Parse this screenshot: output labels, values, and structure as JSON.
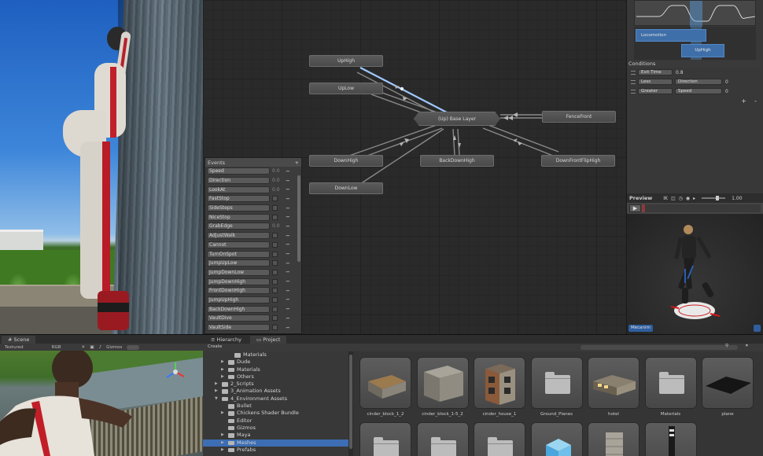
{
  "graph": {
    "states": {
      "uphigh": "UpHigh",
      "uplow": "UpLow",
      "base": "(Up) Base Layer",
      "fencefront": "FenceFront",
      "downhigh": "DownHigh",
      "backdownhigh": "BackDownHigh",
      "downfrontfliphigh": "DownFrontFlipHigh",
      "downlow": "DownLow"
    }
  },
  "events": {
    "title": "Events",
    "add": "+",
    "rows": [
      {
        "name": "Speed",
        "value": "0.0",
        "type": "float"
      },
      {
        "name": "Direction",
        "value": "0.0",
        "type": "float"
      },
      {
        "name": "LookAt",
        "value": "0.0",
        "type": "float"
      },
      {
        "name": "FastStop",
        "type": "bool"
      },
      {
        "name": "SideSteps",
        "type": "bool"
      },
      {
        "name": "NiceStop",
        "type": "bool"
      },
      {
        "name": "GrabEdge",
        "value": "0.0",
        "type": "float"
      },
      {
        "name": "AdjustWalk",
        "type": "bool"
      },
      {
        "name": "Cannot",
        "type": "bool"
      },
      {
        "name": "TurnOnSpot",
        "type": "bool"
      },
      {
        "name": "JumpUpLow",
        "type": "bool"
      },
      {
        "name": "JumpDownLow",
        "type": "bool"
      },
      {
        "name": "JumpDownHigh",
        "type": "bool"
      },
      {
        "name": "FrontDownHigh",
        "type": "bool"
      },
      {
        "name": "JumpUpHigh",
        "type": "bool"
      },
      {
        "name": "BackDownHigh",
        "type": "bool"
      },
      {
        "name": "VaultDive",
        "type": "bool"
      },
      {
        "name": "VaultSide",
        "type": "bool"
      }
    ]
  },
  "inspector": {
    "timeline": {
      "locomotion": "Locomotion",
      "uphigh": "UpHigh"
    },
    "conditions": {
      "title": "Conditions",
      "rows": [
        {
          "a": "Exit Time",
          "b": "",
          "value": "0.8"
        },
        {
          "a": "Less",
          "b": "Direction",
          "value": "0"
        },
        {
          "a": "Greater",
          "b": "Speed",
          "value": "0"
        }
      ],
      "add": "+",
      "remove": "-"
    },
    "preview": {
      "label": "Preview",
      "ik": "IK",
      "speed": "1.00",
      "play": "▶",
      "badge": "Mecanim"
    }
  },
  "scene": {
    "tab": "Scene",
    "toolbar": [
      "Textured",
      "RGB",
      "Gizmos"
    ]
  },
  "bottom": {
    "tabs": [
      "Hierarchy",
      "Project"
    ],
    "create": "Create"
  },
  "tree": [
    {
      "label": "Materials",
      "indent": 3,
      "arrow": ""
    },
    {
      "label": "Dude",
      "indent": 2,
      "arrow": "▶"
    },
    {
      "label": "Materials",
      "indent": 2,
      "arrow": "▶"
    },
    {
      "label": "Others",
      "indent": 2,
      "arrow": "▶"
    },
    {
      "label": "2_Scripts",
      "indent": 1,
      "arrow": "▶"
    },
    {
      "label": "3_Animation Assets",
      "indent": 1,
      "arrow": "▶"
    },
    {
      "label": "4_Environment Assets",
      "indent": 1,
      "arrow": "▼"
    },
    {
      "label": "Bullet",
      "indent": 2,
      "arrow": ""
    },
    {
      "label": "Chickens Shader Bundle",
      "indent": 2,
      "arrow": "▶"
    },
    {
      "label": "Editor",
      "indent": 2,
      "arrow": ""
    },
    {
      "label": "Gizmos",
      "indent": 2,
      "arrow": ""
    },
    {
      "label": "Maya",
      "indent": 2,
      "arrow": "▶"
    },
    {
      "label": "Meshes",
      "indent": 2,
      "arrow": "▶",
      "selected": true
    },
    {
      "label": "Prefabs",
      "indent": 2,
      "arrow": "▶"
    }
  ],
  "assets": [
    {
      "label": "cinder_block_1_2",
      "kind": "block-wood"
    },
    {
      "label": "cinder_block_1-5_2",
      "kind": "block-stone"
    },
    {
      "label": "cinder_house_1",
      "kind": "house"
    },
    {
      "label": "Ground_Planes",
      "kind": "folder"
    },
    {
      "label": "hotel",
      "kind": "hotel"
    },
    {
      "label": "Materials",
      "kind": "folder"
    },
    {
      "label": "plane",
      "kind": "plane"
    },
    {
      "label": "",
      "kind": "folder"
    },
    {
      "label": "",
      "kind": "folder"
    },
    {
      "label": "",
      "kind": "folder"
    },
    {
      "label": "",
      "kind": "cube"
    },
    {
      "label": "",
      "kind": "cylinder"
    },
    {
      "label": "",
      "kind": "lamp"
    }
  ]
}
